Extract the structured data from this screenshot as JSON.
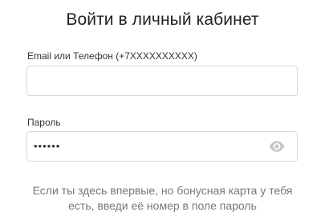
{
  "title": "Войти в личный кабинет",
  "login": {
    "label": "Email или Телефон (+7XXXXXXXXXX)",
    "value": "",
    "placeholder": ""
  },
  "password": {
    "label": "Пароль",
    "masked_value": "••••••",
    "show_icon": "eye-icon"
  },
  "hint": "Если ты здесь впервые, но бонусная карта у тебя есть, введи её номер в поле пароль",
  "colors": {
    "text": "#222222",
    "label": "#333333",
    "hint": "#777777",
    "border": "#d9d9d9",
    "icon": "#c6c6c6"
  }
}
